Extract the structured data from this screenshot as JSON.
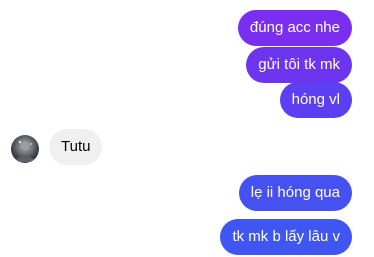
{
  "colors": {
    "purple_bubble": "#7a2ff0",
    "violet_bubble": "#5b3ff0",
    "blue_bubble": "#3f56f2",
    "incoming_bubble": "#f0f0f0"
  },
  "messages": [
    {
      "side": "out",
      "text": "đúng acc nhe"
    },
    {
      "side": "out",
      "text": "gửi tôi tk mk"
    },
    {
      "side": "out",
      "text": "hóng vl"
    },
    {
      "side": "in",
      "text": "Tutu"
    },
    {
      "side": "out",
      "text": "lẹ ii hóng qua"
    },
    {
      "side": "out",
      "text": "tk mk b lấy lâu v"
    }
  ],
  "avatar": {
    "icon": "user-avatar"
  }
}
